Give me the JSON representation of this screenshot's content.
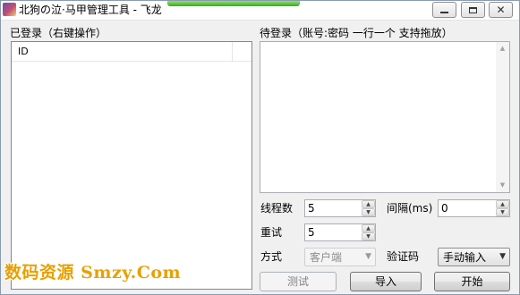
{
  "window": {
    "title": "北狗の泣·马甲管理工具 - 飞龙",
    "controls": {
      "minimize": "minimize",
      "maximize": "maximize",
      "close": "close"
    }
  },
  "logged_in": {
    "label": "已登录（右键操作）",
    "columns": [
      "ID"
    ]
  },
  "pending": {
    "label": "待登录（账号:密码 一行一个 支持拖放）",
    "value": ""
  },
  "settings": {
    "threads_label": "线程数",
    "threads_value": "5",
    "interval_label": "间隔(ms)",
    "interval_value": "0",
    "retry_label": "重试",
    "retry_value": "5",
    "method_label": "方式",
    "method_value": "客户端",
    "captcha_label": "验证码",
    "captcha_value": "手动输入"
  },
  "buttons": {
    "test": "测试",
    "import": "导入",
    "start": "开始"
  },
  "watermark": "数码资源 Smzy.Com",
  "colors": {
    "watermark": "#e8a000",
    "title_progress": "#3aa823"
  }
}
